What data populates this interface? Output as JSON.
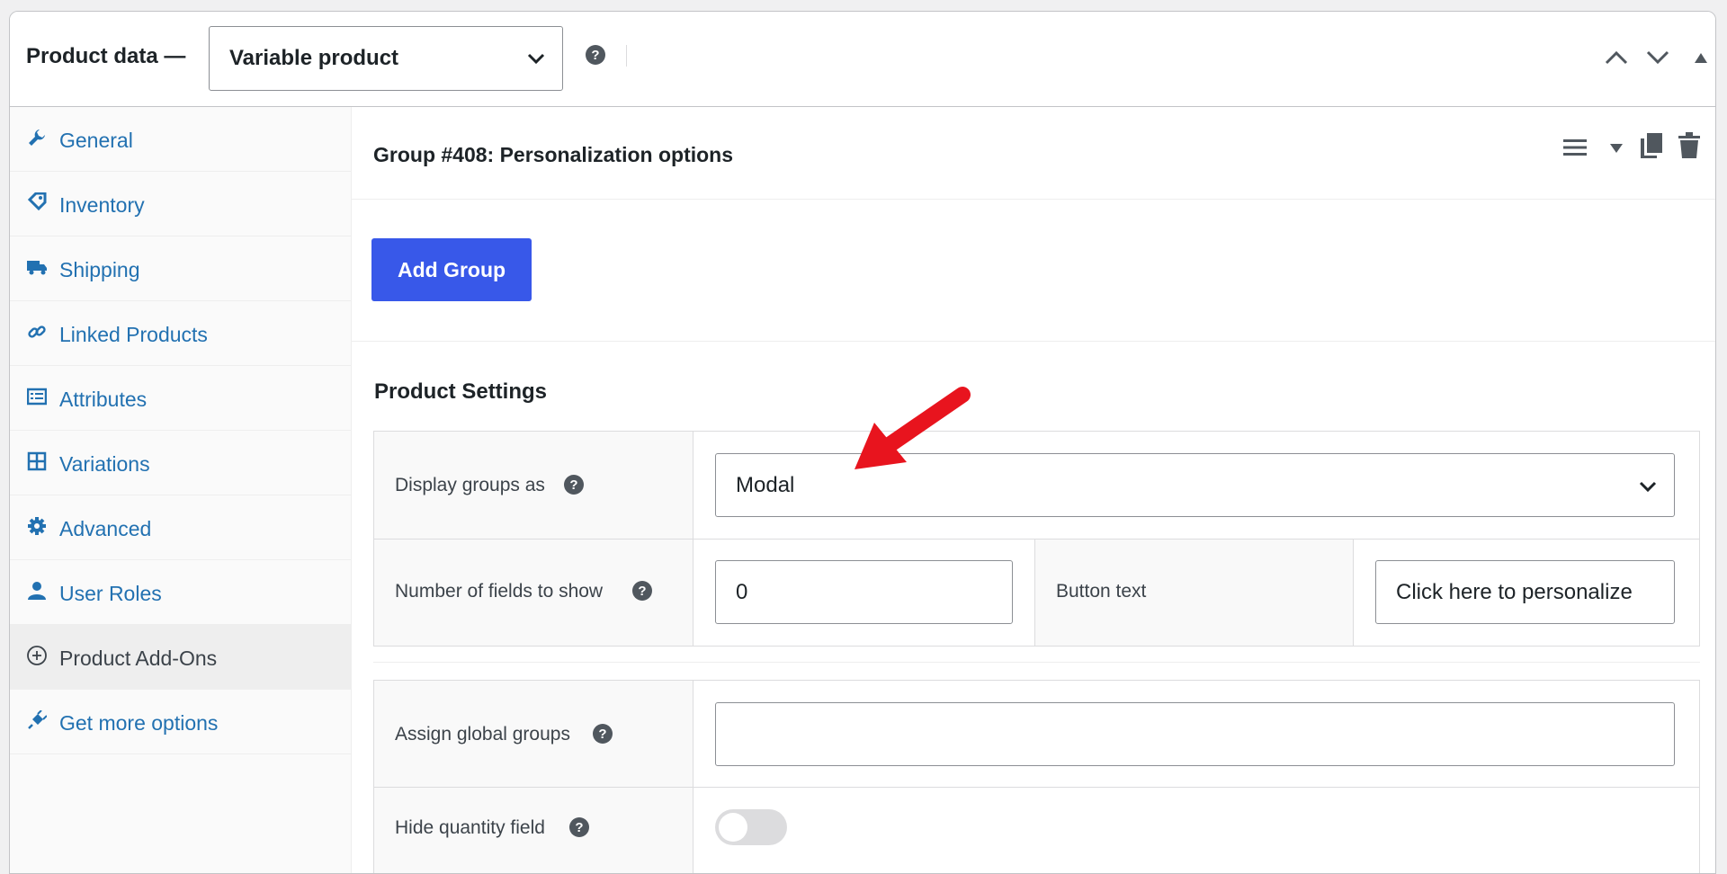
{
  "header": {
    "title": "Product data —",
    "product_type": "Variable product",
    "help": "?"
  },
  "sidebar": {
    "items": [
      {
        "label": "General",
        "icon": "wrench-icon"
      },
      {
        "label": "Inventory",
        "icon": "tag-icon"
      },
      {
        "label": "Shipping",
        "icon": "truck-icon"
      },
      {
        "label": "Linked Products",
        "icon": "link-icon"
      },
      {
        "label": "Attributes",
        "icon": "list-icon"
      },
      {
        "label": "Variations",
        "icon": "grid-icon"
      },
      {
        "label": "Advanced",
        "icon": "gear-icon"
      },
      {
        "label": "User Roles",
        "icon": "user-icon"
      },
      {
        "label": "Product Add-Ons",
        "icon": "plus-circle-icon",
        "active": true
      },
      {
        "label": "Get more options",
        "icon": "plug-icon"
      }
    ]
  },
  "main": {
    "group_title": "Group #408: Personalization options",
    "add_group_label": "Add Group",
    "settings_title": "Product Settings",
    "display_groups": {
      "label": "Display groups as",
      "value": "Modal"
    },
    "num_fields": {
      "label": "Number of fields to show",
      "value": "0"
    },
    "button_text": {
      "label": "Button text",
      "value": "Click here to personalize"
    },
    "assign_global": {
      "label": "Assign global groups",
      "value": ""
    },
    "hide_quantity": {
      "label": "Hide quantity field",
      "enabled": false
    }
  },
  "colors": {
    "accent": "#3858e9",
    "link": "#2271b1",
    "annotation_arrow": "#e8141e"
  }
}
